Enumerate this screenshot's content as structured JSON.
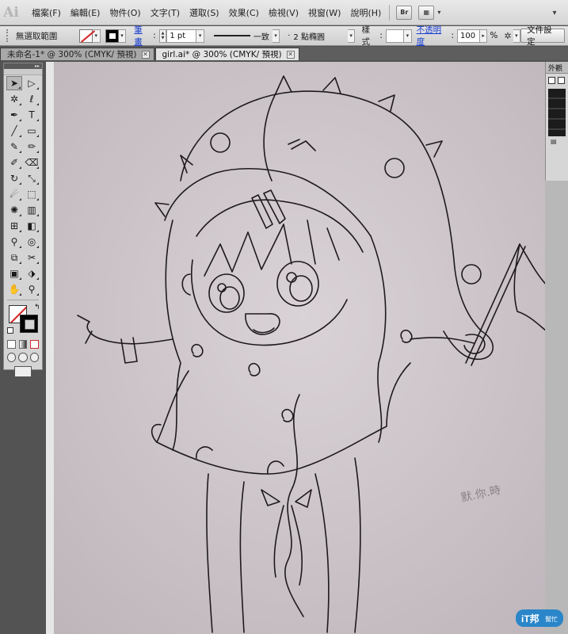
{
  "app": {
    "logo": "Ai"
  },
  "menu": {
    "items": [
      "檔案(F)",
      "編輯(E)",
      "物件(O)",
      "文字(T)",
      "選取(S)",
      "效果(C)",
      "檢視(V)",
      "視窗(W)",
      "說明(H)"
    ],
    "bridge_label": "Br"
  },
  "control": {
    "selection_status": "無選取範圍",
    "stroke_link": "筆畫",
    "stroke_weight": "1 pt",
    "uniform_label": "一致",
    "brush_label": "2 點橢圓",
    "style_label": "樣式",
    "opacity_link": "不透明度",
    "opacity_value": "100",
    "opacity_unit": "%",
    "doc_setup": "文件設定"
  },
  "tabs": [
    {
      "label": "未命名-1* @ 300% (CMYK/ 預視)",
      "active": false
    },
    {
      "label": "girl.ai* @ 300% (CMYK/ 預視)",
      "active": true
    }
  ],
  "tools": {
    "rows": [
      [
        "selection-tool-icon",
        "direct-selection-tool-icon"
      ],
      [
        "magic-wand-tool-icon",
        "lasso-tool-icon"
      ],
      [
        "pen-tool-icon",
        "type-tool-icon"
      ],
      [
        "line-segment-tool-icon",
        "rectangle-tool-icon"
      ],
      [
        "paintbrush-tool-icon",
        "pencil-tool-icon"
      ],
      [
        "blob-brush-tool-icon",
        "eraser-tool-icon"
      ],
      [
        "rotate-tool-icon",
        "scale-tool-icon"
      ],
      [
        "warp-tool-icon",
        "free-transform-tool-icon"
      ],
      [
        "symbol-sprayer-tool-icon",
        "column-graph-tool-icon"
      ],
      [
        "mesh-tool-icon",
        "gradient-tool-icon"
      ],
      [
        "eyedropper-tool-icon",
        "blend-tool-icon"
      ],
      [
        "live-paint-tool-icon",
        "slice-tool-icon"
      ],
      [
        "artboard-tool-icon",
        "slice-select-tool-icon"
      ],
      [
        "hand-tool-icon",
        "zoom-tool-icon"
      ]
    ],
    "glyphs": {
      "selection-tool-icon": "➤",
      "direct-selection-tool-icon": "▷",
      "magic-wand-tool-icon": "✲",
      "lasso-tool-icon": "ℓ",
      "pen-tool-icon": "✒",
      "type-tool-icon": "T",
      "line-segment-tool-icon": "╱",
      "rectangle-tool-icon": "▭",
      "paintbrush-tool-icon": "✎",
      "pencil-tool-icon": "✏",
      "blob-brush-tool-icon": "✐",
      "eraser-tool-icon": "⌫",
      "rotate-tool-icon": "↻",
      "scale-tool-icon": "⤡",
      "warp-tool-icon": "☄",
      "free-transform-tool-icon": "⬚",
      "symbol-sprayer-tool-icon": "✺",
      "column-graph-tool-icon": "▥",
      "mesh-tool-icon": "⊞",
      "gradient-tool-icon": "◧",
      "eyedropper-tool-icon": "⚲",
      "blend-tool-icon": "◎",
      "live-paint-tool-icon": "⧉",
      "slice-tool-icon": "✂",
      "artboard-tool-icon": "▣",
      "slice-select-tool-icon": "⬗",
      "hand-tool-icon": "✋",
      "zoom-tool-icon": "⚲"
    }
  },
  "appearance": {
    "tab_label": "外觀"
  },
  "canvas": {
    "handwriting": "默.你.時"
  },
  "watermark": {
    "brand": "iT邦",
    "sub": "幫忙"
  },
  "colors": {
    "canvas_bg": "#cfc8cc",
    "line": "#1e1a1c",
    "stroke_none": "#d12a2a",
    "link": "#1a3fcf"
  }
}
